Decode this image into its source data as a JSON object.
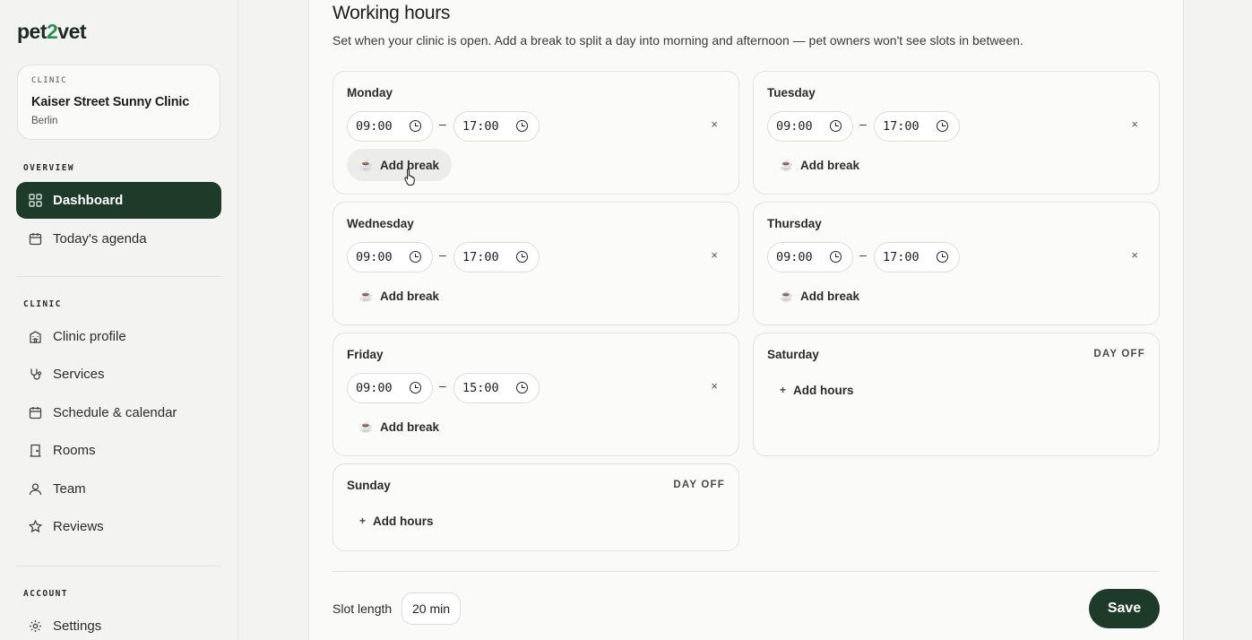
{
  "app": {
    "logo_left": "pet",
    "logo_mid": "2",
    "logo_right": "vet"
  },
  "sidebar": {
    "clinic_card": {
      "label": "CLINIC",
      "name": "Kaiser Street Sunny Clinic",
      "city": "Berlin"
    },
    "sections": {
      "overview": "OVERVIEW",
      "clinic": "CLINIC",
      "account": "ACCOUNT"
    },
    "items": [
      {
        "label": "Dashboard",
        "icon": "grid-icon",
        "active": true
      },
      {
        "label": "Today's agenda",
        "icon": "calendar-icon"
      },
      {
        "label": "Clinic profile",
        "icon": "building-icon"
      },
      {
        "label": "Services",
        "icon": "stethoscope-icon"
      },
      {
        "label": "Schedule & calendar",
        "icon": "calendar-icon"
      },
      {
        "label": "Rooms",
        "icon": "door-icon"
      },
      {
        "label": "Team",
        "icon": "user-icon"
      },
      {
        "label": "Reviews",
        "icon": "star-icon"
      },
      {
        "label": "Settings",
        "icon": "gear-icon"
      }
    ]
  },
  "main": {
    "title": "Working hours",
    "subtitle": "Set when your clinic is open. Add a break to split a day into morning and afternoon — pet owners won't see slots in between.",
    "days": {
      "monday": {
        "name": "Monday",
        "open": "09:00",
        "close": "17:00",
        "action": "Add break"
      },
      "tuesday": {
        "name": "Tuesday",
        "open": "09:00",
        "close": "17:00",
        "action": "Add break"
      },
      "wednesday": {
        "name": "Wednesday",
        "open": "09:00",
        "close": "17:00",
        "action": "Add break"
      },
      "thursday": {
        "name": "Thursday",
        "open": "09:00",
        "close": "17:00",
        "action": "Add break"
      },
      "friday": {
        "name": "Friday",
        "open": "09:00",
        "close": "15:00",
        "action": "Add break"
      },
      "saturday": {
        "name": "Saturday",
        "status": "DAY OFF",
        "action": "Add hours"
      },
      "sunday": {
        "name": "Sunday",
        "status": "DAY OFF",
        "action": "Add hours"
      }
    },
    "range_separator": "–",
    "remove_glyph": "×",
    "slot_length_label": "Slot length",
    "slot_length_value": "20 min",
    "save_label": "Save"
  },
  "colors": {
    "accent": "#1e3a29",
    "logo_two": "#2f8f4e",
    "background": "#f3f3f1"
  }
}
